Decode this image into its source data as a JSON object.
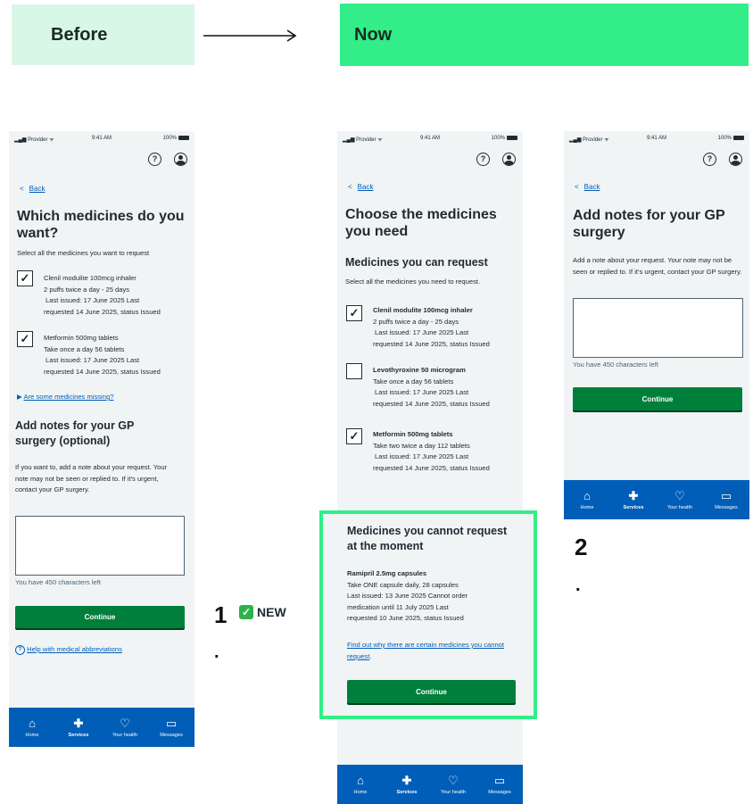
{
  "header": {
    "before": "Before",
    "now": "Now"
  },
  "colors": {
    "before_bg": "#d9f7e6",
    "now_bg": "#33ee88",
    "highlight": "#33ee88",
    "nhs_blue": "#005eb8",
    "green": "#007f3b"
  },
  "status": {
    "provider": "Provider",
    "time": "9:41 AM",
    "battery": "100%"
  },
  "nav": {
    "home": "Home",
    "services": "Services",
    "health": "Your health",
    "messages": "Messages"
  },
  "phone1": {
    "back": "Back",
    "title": "Which medicines do you want?",
    "hint": "Select all the medicines you want to request",
    "med1": {
      "name": "Clenil modulite 100mcg inhaler",
      "l2": "2 puffs twice a day - 25 days",
      "l3": "Last issued: 17 June 2025 Last",
      "l4": "requested 14 June 2025, status Issued"
    },
    "med2": {
      "name": "Metformin 500mg tablets",
      "l2": "Take once a day 56 tablets",
      "l3": "Last issued: 17 June 2025 Last",
      "l4": "requested 14 June 2025, status Issued"
    },
    "missing": "Are some medicines missing?",
    "notes_title": "Add notes for your GP surgery (optional)",
    "notes_hint": "If you want to, add a note about your request. Your note may not be seen or replied to. If it's urgent, contact your GP surgery.",
    "chars": "You have 450 characters left",
    "continue": "Continue",
    "help": "Help with medical abbreviations"
  },
  "phone2": {
    "back": "Back",
    "title": "Choose the medicines you need",
    "sub": "Medicines you can request",
    "hint": "Select all the medicines you need to request.",
    "med1": {
      "name": "Clenil modulite 100mcg inhaler",
      "l2": "2 puffs twice a day - 25 days",
      "l3": "Last issued: 17 June 2025 Last",
      "l4": "requested 14 June 2025, status Issued"
    },
    "med2": {
      "name": "Levothyroxine 50 microgram",
      "l2": "Take once a day 56 tablets",
      "l3": "Last issued: 17 June 2025 Last",
      "l4": "requested 14 June 2025, status Issued"
    },
    "med3": {
      "name": "Metformin 500mg tablets",
      "l2": "Take two twice a day 112 tablets",
      "l3": "Last issued: 17 June 2025 Last",
      "l4": "requested 14 June 2025, status Issued"
    },
    "cannot_title": "Medicines you cannot request at the moment",
    "cannot_name": "Ramipril 2.5mg capsules",
    "cannot_l2": "Take ONE capsule daily, 28 capsules",
    "cannot_l3": "Last issued: 13 June 2025 Cannot order",
    "cannot_l4": "medication until 11 July 2025 Last",
    "cannot_l5": "requested 10 June 2025, status Issued",
    "find_out": "Find out why there are certain medicines you cannot request",
    "continue": "Continue"
  },
  "phone3": {
    "title": "Add notes for your GP surgery",
    "hint": "Add a note about your request. Your note may not be seen or replied to. If it's urgent, contact your GP surgery.",
    "chars": "You have 450 characters left",
    "continue": "Continue",
    "back": "Back"
  },
  "label1": {
    "num": "1",
    "new": "NEW",
    "dot": "."
  },
  "label2": {
    "num": "2",
    "dot": "."
  }
}
